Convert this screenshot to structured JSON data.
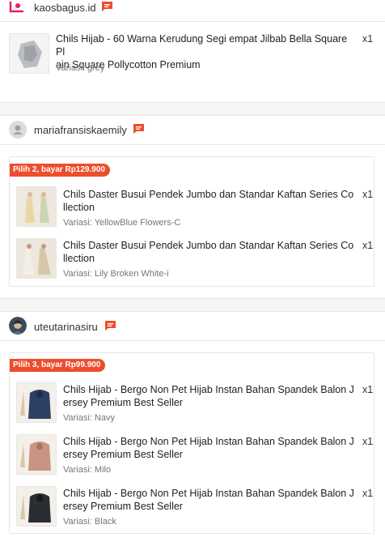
{
  "shops": [
    {
      "name": "kaosbagus.id",
      "avatar_icon": "shop-logo-icon",
      "chat_icon": "chat-icon",
      "items": [
        {
          "title": "Chils Hijab - 60 Warna Kerudung Segi empat Jilbab Bella Square Plain Square Pollycotton Premium",
          "title_line1": "Chils Hijab - 60 Warna Kerudung Segi empat Jilbab Bella Square Pl",
          "title_line2": "ain Square Pollycotton Premium",
          "qty": "x1",
          "variant": "Variasi: grey"
        }
      ]
    },
    {
      "name": "mariafransiskaemily",
      "avatar_icon": "default-user-icon",
      "chat_icon": "chat-icon",
      "bundle_label": "Pilih 2, bayar Rp129.900",
      "items": [
        {
          "title_line1": "Chils Daster Busui Pendek Jumbo dan Standar Kaftan Series Co",
          "title_line2": "llection",
          "qty": "x1",
          "variant": "Variasi: YellowBlue Flowers-C"
        },
        {
          "title_line1": "Chils Daster Busui Pendek Jumbo dan Standar Kaftan Series Co",
          "title_line2": "llection",
          "qty": "x1",
          "variant": "Variasi: Lily Broken White-i"
        }
      ]
    },
    {
      "name": "uteutarinasiru",
      "avatar_icon": "user-photo-icon",
      "chat_icon": "chat-icon",
      "bundle_label": "Pilih 3, bayar Rp99.900",
      "items": [
        {
          "title_line1": "Chils Hijab - Bergo Non Pet Hijab Instan Bahan Spandek Balon J",
          "title_line2": "ersey Premium Best Seller",
          "qty": "x1",
          "variant": "Variasi: Navy"
        },
        {
          "title_line1": "Chils Hijab - Bergo Non Pet Hijab Instan Bahan Spandek Balon J",
          "title_line2": "ersey Premium Best Seller",
          "qty": "x1",
          "variant": "Variasi: Milo"
        },
        {
          "title_line1": "Chils Hijab - Bergo Non Pet Hijab Instan Bahan Spandek Balon J",
          "title_line2": "ersey Premium Best Seller",
          "qty": "x1",
          "variant": "Variasi: Black"
        }
      ]
    }
  ],
  "colors": {
    "accent": "#ee4d2d",
    "text_primary": "#222222",
    "text_secondary": "#757575"
  }
}
